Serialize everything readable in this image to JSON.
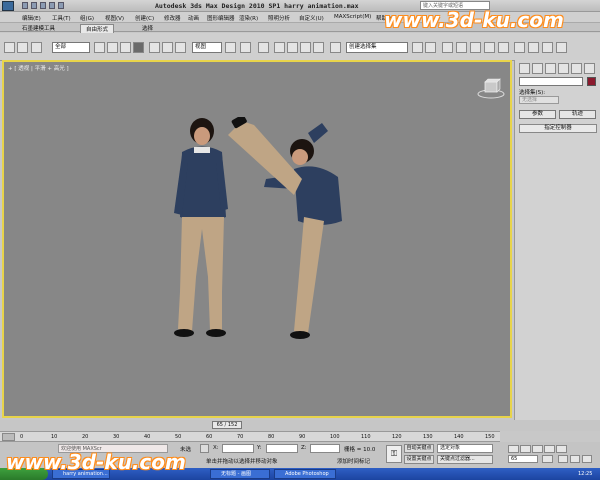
{
  "title_bar": {
    "title": "Autodesk 3ds Max Design 2010 SP1     harry animation.max",
    "search_placeholder": "键入关键字或短语"
  },
  "menu": [
    "编辑(E)",
    "工具(T)",
    "组(G)",
    "视图(V)",
    "创建(C)",
    "修改器",
    "动画",
    "图形编辑器",
    "渲染(R)",
    "照明分析",
    "自定义(U)",
    "MAXScript(M)",
    "帮助(H)"
  ],
  "ribbon_tabs": [
    "石墨建模工具",
    "自由形式",
    "选择"
  ],
  "toolbar": {
    "selection_filter": "全部",
    "ref_coord": "视图",
    "named_selection": "创建选择集",
    "snap_percent": "n%"
  },
  "viewport": {
    "label": "+ [ 透视 | 平滑 + 高光 ]"
  },
  "command_panel": {
    "selection_set_label": "选择集(S):",
    "selection_set_value": "无选择",
    "button_params": "参数",
    "button_track": "轨迹",
    "rollout_title": "指定控制器"
  },
  "timeline": {
    "frame_indicator": "65 / 152",
    "ticks": [
      "0",
      "10",
      "20",
      "30",
      "40",
      "50",
      "60",
      "70",
      "80",
      "90",
      "100",
      "110",
      "120",
      "130",
      "140",
      "150"
    ]
  },
  "status": {
    "selected": "未选",
    "x_label": "X:",
    "x_value": "",
    "y_label": "Y:",
    "z_label": "Z:",
    "grid_label": "栅格 = 10.0",
    "auto_key": "自动关键点",
    "set_key": "设置关键点",
    "selected_object_dropdown": "选定对象",
    "key_filter": "关键点过滤器...",
    "frame_value": "65",
    "prompt_1": "单击并拖动以选择并移动对象",
    "prompt_2": "添加时间标记",
    "script_label": "欢迎使用 MAXScr"
  },
  "taskbar": {
    "items": [
      "harry animation...",
      "无标题 - 画图",
      "Adobe Photoshop"
    ],
    "clock": "12:25"
  },
  "watermarks": [
    "www.3d-ku.com",
    "www.3d-ku.com"
  ],
  "colors": {
    "viewport_bg": "#878787",
    "active_border": "#e8d44a",
    "taskbar": "#2452b8"
  }
}
